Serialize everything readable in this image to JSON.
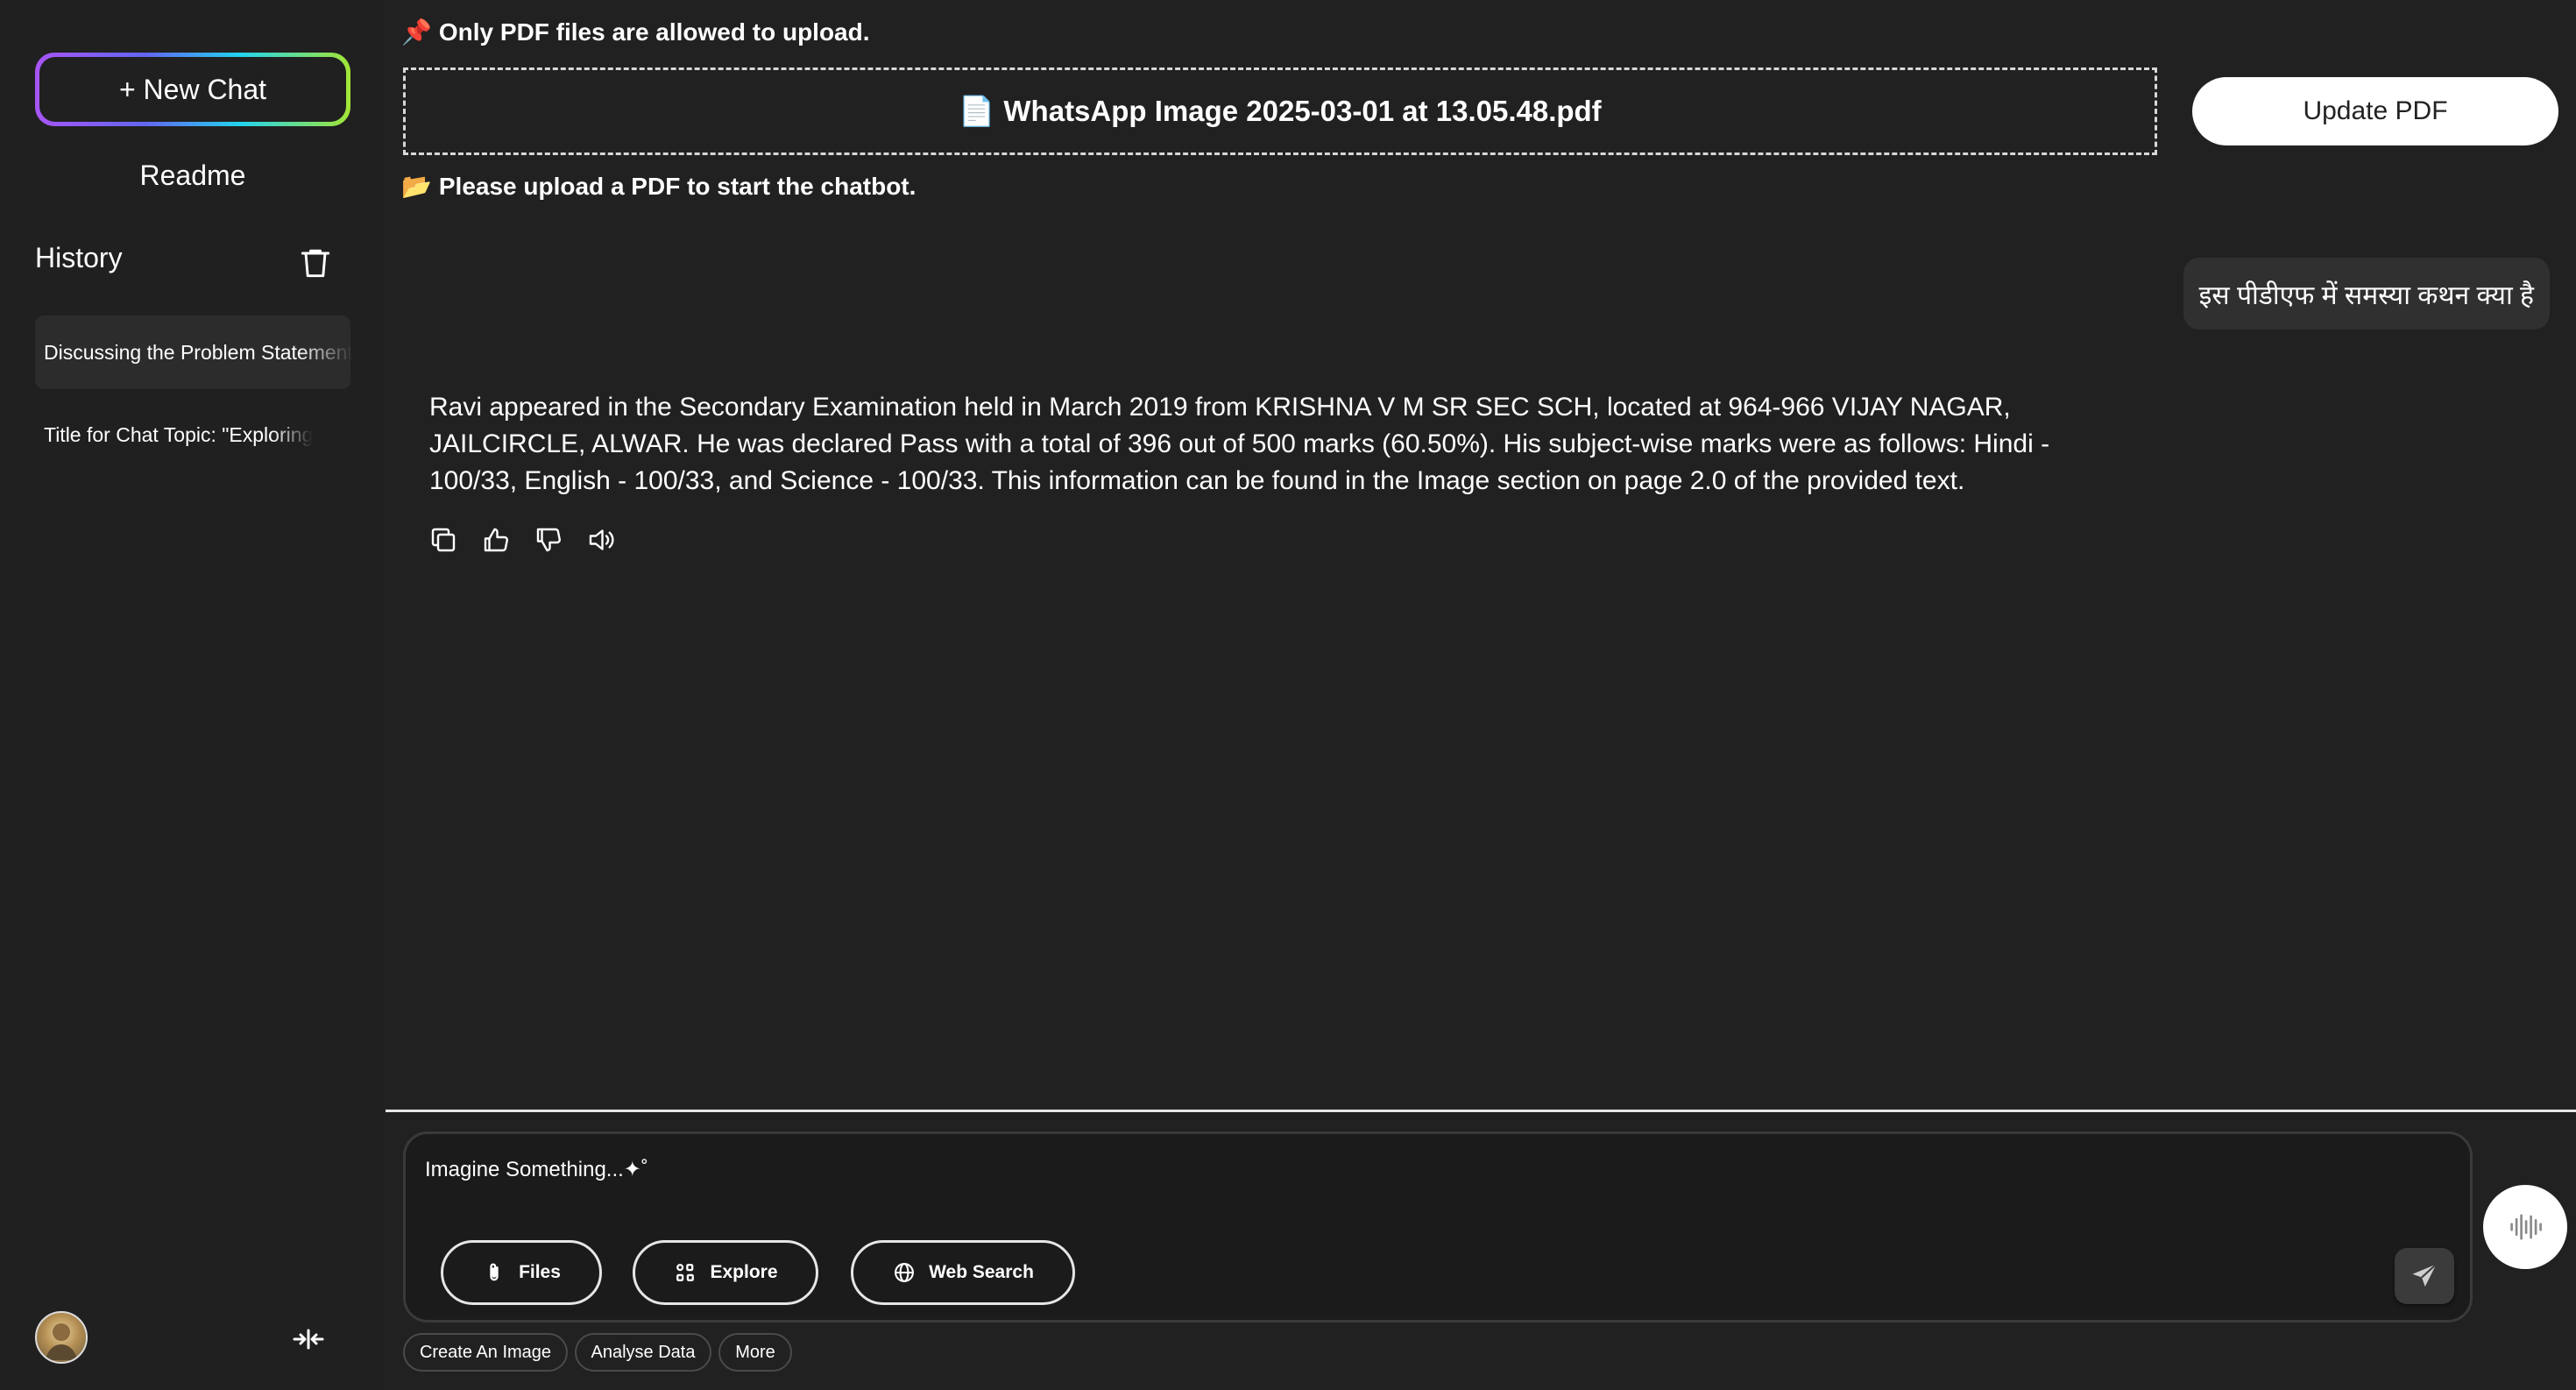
{
  "sidebar": {
    "new_chat_label": "+ New Chat",
    "readme_label": "Readme",
    "history_title": "History",
    "history_items": [
      {
        "title": "Discussing the Problem Statement"
      },
      {
        "title": "Title for Chat Topic: \"Exploring the PDF Contents\""
      }
    ]
  },
  "upload": {
    "notice_icon": "📌",
    "notice": "Only PDF files are allowed to upload.",
    "file_icon": "📄",
    "file_name": "WhatsApp Image 2025-03-01 at 13.05.48.pdf",
    "update_label": "Update PDF",
    "status_icon": "📂",
    "status": "Please upload a PDF to start the chatbot."
  },
  "chat": {
    "user_message": "इस पीडीएफ में समस्या कथन क्या है",
    "bot_message": "Ravi appeared in the Secondary Examination held in March 2019 from KRISHNA V M SR SEC SCH, located at 964-966 VIJAY NAGAR, JAILCIRCLE, ALWAR. He was declared Pass with a total of 396 out of 500 marks (60.50%). His subject-wise marks were as follows: Hindi - 100/33, English - 100/33, and Science - 100/33. This information can be found in the Image section on page 2.0 of the provided text."
  },
  "composer": {
    "placeholder": "Imagine Something...✦˚",
    "files_label": "Files",
    "explore_label": "Explore",
    "web_search_label": "Web Search"
  },
  "chips": [
    "Create An Image",
    "Analyse Data",
    "More"
  ]
}
